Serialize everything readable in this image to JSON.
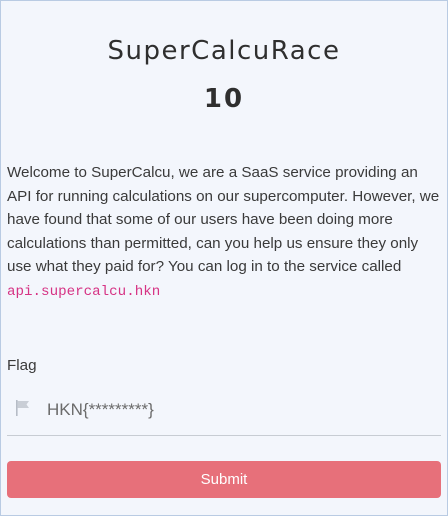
{
  "challenge": {
    "title": "SuperCalcuRace",
    "points": "10",
    "description_text": "Welcome to SuperCalcu, we are a SaaS service providing an API for running calculations on our supercomputer. However, we have found that some of our users have been doing more calculations than permitted, can you help us ensure they only use what they paid for? You can log in to the service called ",
    "service_name": "api.supercalcu.hkn"
  },
  "form": {
    "flag_label": "Flag",
    "flag_placeholder": "HKN{*********}",
    "submit_label": "Submit"
  },
  "colors": {
    "submit": "#e7707a",
    "code": "#d63384",
    "background": "#f3f6fc"
  },
  "icons": {
    "flag": "flag-icon"
  }
}
